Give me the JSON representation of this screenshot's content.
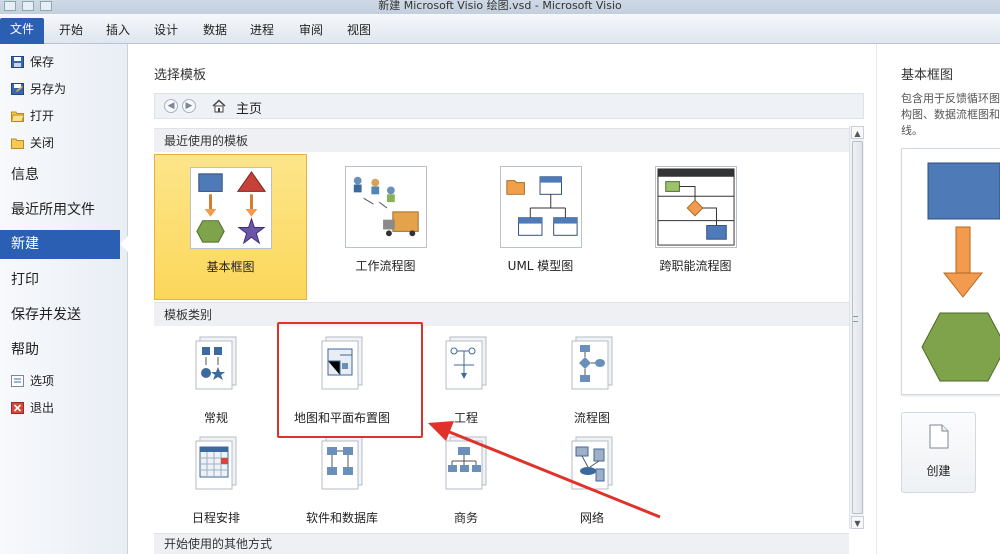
{
  "window": {
    "title": "新建 Microsoft Visio 绘图.vsd  -  Microsoft Visio"
  },
  "ribbon": {
    "file_tab": "文件",
    "tabs": [
      "开始",
      "插入",
      "设计",
      "数据",
      "进程",
      "审阅",
      "视图"
    ]
  },
  "sidebar": {
    "save": "保存",
    "save_as": "另存为",
    "open": "打开",
    "close": "关闭",
    "info": "信息",
    "recent": "最近所用文件",
    "new": "新建",
    "print": "打印",
    "save_send": "保存并发送",
    "help": "帮助",
    "options": "选项",
    "exit": "退出"
  },
  "main": {
    "section_title": "选择模板",
    "breadcrumb_home": "主页",
    "recent_header": "最近使用的模板",
    "recent_templates": [
      {
        "label": "基本框图",
        "selected": true
      },
      {
        "label": "工作流程图"
      },
      {
        "label": "UML 模型图"
      },
      {
        "label": "跨职能流程图"
      }
    ],
    "categories_header": "模板类别",
    "categories": [
      {
        "label": "常规"
      },
      {
        "label": "地图和平面布置图"
      },
      {
        "label": "工程"
      },
      {
        "label": "流程图"
      },
      {
        "label": "日程安排"
      },
      {
        "label": "软件和数据库"
      },
      {
        "label": "商务"
      },
      {
        "label": "网络"
      }
    ],
    "other_ways_header": "开始使用的其他方式"
  },
  "preview": {
    "title": "基本框图",
    "description": "包含用于反馈循环图构图、数据流框图和线。",
    "create_label": "创建"
  },
  "colors": {
    "file_tab": "#2b5fb3",
    "selected_tile": "#fbd75a",
    "annotation_red": "#e0322a",
    "shape_blue": "#4f7ab8",
    "shape_green": "#7ea34a",
    "shape_orange": "#f29b4f"
  },
  "icons": [
    "save-icon",
    "save-as-icon",
    "open-folder-icon",
    "close-folder-icon",
    "options-icon",
    "exit-icon",
    "back-icon",
    "forward-icon",
    "home-icon",
    "new-document-icon"
  ]
}
